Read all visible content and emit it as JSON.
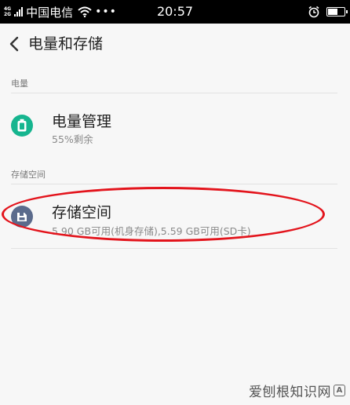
{
  "status_bar": {
    "network_top": "4G",
    "network_bottom": "2G",
    "carrier": "中国电信",
    "time": "20:57",
    "battery_level": 0.62
  },
  "header": {
    "title": "电量和存储"
  },
  "sections": [
    {
      "label": "电量",
      "items": [
        {
          "title": "电量管理",
          "subtitle": "55%剩余",
          "icon": "battery-icon",
          "icon_color": "#16b58f"
        }
      ]
    },
    {
      "label": "存储空间",
      "items": [
        {
          "title": "存储空间",
          "subtitle": "5.90 GB可用(机身存储),5.59 GB可用(SD卡)",
          "icon": "storage-icon",
          "icon_color": "#5b6b8c"
        }
      ]
    }
  ],
  "annotation": {
    "color": "#e3141c"
  },
  "watermark": {
    "text": "爱刨根知识网",
    "badge": "A"
  }
}
